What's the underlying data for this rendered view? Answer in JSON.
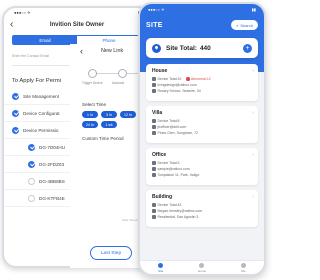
{
  "back_phone": {
    "status_left": "●●●○○ ✈",
    "status_right": "▮▮",
    "title": "Invition Site Owner",
    "tabs": [
      {
        "label": "Email"
      },
      {
        "label": "Phone"
      }
    ],
    "input_placeholder": "Enter the Contact Email",
    "apply_label": "To Apply For Permi",
    "permissions": [
      {
        "label": "Site Management",
        "checked": true,
        "indent": false
      },
      {
        "label": "Device Configurat",
        "checked": true,
        "indent": false
      },
      {
        "label": "Device Permissio",
        "checked": true,
        "indent": false
      },
      {
        "label": "DG-7D04HU",
        "checked": true,
        "indent": true
      },
      {
        "label": "DG-2FDZ03",
        "checked": true,
        "indent": true
      },
      {
        "label": "DG-4BB8BS",
        "checked": false,
        "indent": true
      },
      {
        "label": "DG-KTFB4E",
        "checked": false,
        "indent": true
      }
    ]
  },
  "middle_panel": {
    "title": "New Link",
    "steps": [
      "Trigger Device",
      "Associat"
    ],
    "select_time_label": "Select Time",
    "chips": [
      "1 hr",
      "3 hr",
      "12 hr",
      "24 hr",
      "1 wk"
    ],
    "custom_period_label": "Custom Time Period",
    "note": "Start Time Reserve",
    "button_label": "Last Step"
  },
  "front_phone": {
    "status_left": "●●●○○ ✈",
    "status_right": "▮▮",
    "app_title": "SITE",
    "search_label": "Search",
    "total_label": "Site Total:",
    "total_value": "440",
    "sites": [
      {
        "name": "House",
        "device_text": "Device Total:10",
        "warning_text": "Abnormal:12",
        "email": "livingdesign@ratbox.com",
        "address": "Rosary School, Seawire, 34"
      },
      {
        "name": "Villa",
        "device_text": "Device Total:8",
        "warning_text": "",
        "email": "jbofficer@dell.com",
        "address": "Pines Glen, Songtown, 72"
      },
      {
        "name": "Office",
        "device_text": "Device Total:3",
        "warning_text": "",
        "email": "sample@ratbox.com",
        "address": "Sunpalace 11, Park, Indigo"
      },
      {
        "name": "Building",
        "device_text": "Device Total:43",
        "warning_text": "",
        "email": "Megan.hensley@ratbox.com",
        "address": "Residential, San Agustin 3"
      }
    ],
    "nav": [
      {
        "label": "Site",
        "active": true
      },
      {
        "label": "Home",
        "active": false
      },
      {
        "label": "Me",
        "active": false
      }
    ]
  },
  "colors": {
    "primary": "#2f6fe4",
    "accent_dark": "#1e5fd6",
    "warning": "#e04848"
  }
}
